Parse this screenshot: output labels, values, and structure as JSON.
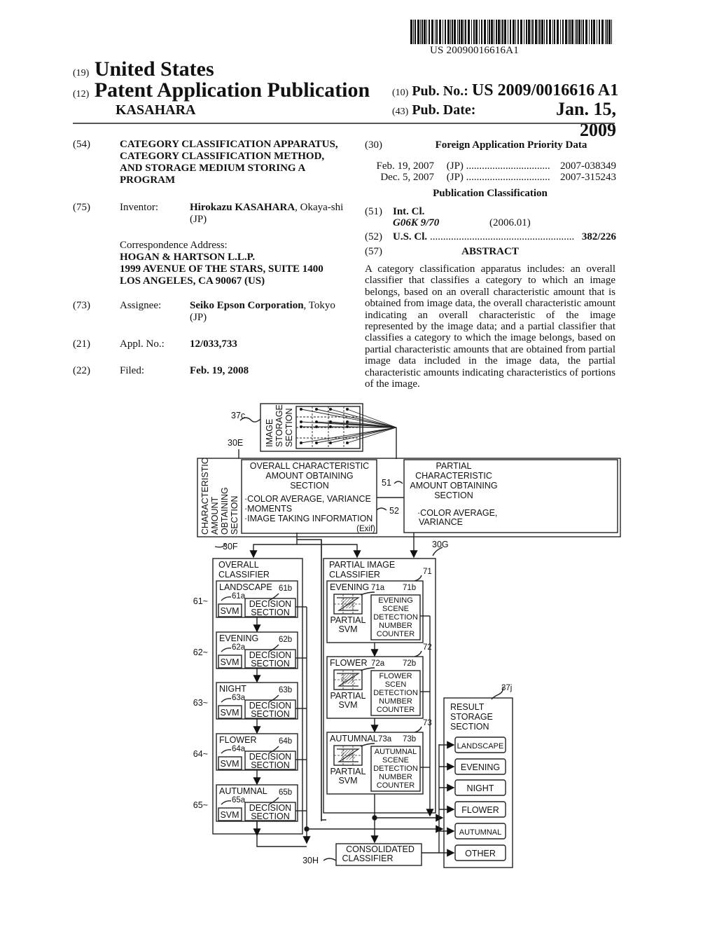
{
  "barcode": {
    "number": "US 20090016616A1"
  },
  "header": {
    "country_code": "(19)",
    "country": "United States",
    "type_code": "(12)",
    "type": "Patent Application Publication",
    "applicant": "KASAHARA",
    "pub_no_code": "(10)",
    "pub_no_label": "Pub. No.:",
    "pub_no": "US 2009/0016616 A1",
    "pub_date_code": "(43)",
    "pub_date_label": "Pub. Date:",
    "pub_date": "Jan. 15, 2009"
  },
  "left": {
    "title_code": "(54)",
    "title_lines": [
      "CATEGORY CLASSIFICATION APPARATUS,",
      "CATEGORY CLASSIFICATION METHOD,",
      "AND STORAGE MEDIUM STORING A",
      "PROGRAM"
    ],
    "inventor_code": "(75)",
    "inventor_label": "Inventor:",
    "inventor_name": "Hirokazu KASAHARA",
    "inventor_loc": ", Okaya-shi",
    "inventor_country": "(JP)",
    "corr_label": "Correspondence Address:",
    "corr_lines": [
      "HOGAN & HARTSON L.L.P.",
      "1999 AVENUE OF THE STARS, SUITE 1400",
      "LOS ANGELES, CA 90067 (US)"
    ],
    "assignee_code": "(73)",
    "assignee_label": "Assignee:",
    "assignee_name": "Seiko Epson Corporation",
    "assignee_loc": ", Tokyo",
    "assignee_country": "(JP)",
    "appl_code": "(21)",
    "appl_label": "Appl. No.:",
    "appl_no": "12/033,733",
    "filed_code": "(22)",
    "filed_label": "Filed:",
    "filed_date": "Feb. 19, 2008"
  },
  "right": {
    "foreign_code": "(30)",
    "foreign_title": "Foreign Application Priority Data",
    "priorities": [
      {
        "date": "Feb. 19, 2007",
        "country": "(JP)",
        "dots": "................................",
        "number": "2007-038349"
      },
      {
        "date": "Dec. 5, 2007",
        "country": "(JP)",
        "dots": "................................",
        "number": "2007-315243"
      }
    ],
    "pub_class_title": "Publication Classification",
    "intcl_code": "(51)",
    "intcl_label": "Int. Cl.",
    "intcl_class": "G06K 9/70",
    "intcl_version": "(2006.01)",
    "uscl_code": "(52)",
    "uscl_label": "U.S. Cl.",
    "uscl_dots": ".......................................................",
    "uscl_value": "382/226",
    "abstract_code": "(57)",
    "abstract_title": "ABSTRACT",
    "abstract_text": "A category classification apparatus includes: an overall classifier that classifies a category to which an image belongs, based on an overall characteristic amount that is obtained from image data, the overall characteristic amount indicating an overall characteristic of the image represented by the image data; and a partial classifier that classifies a category to which the image belongs, based on partial characteristic amounts that are obtained from partial image data included in the image data, the partial characteristic amounts indicating characteristics of portions of the image."
  },
  "figure": {
    "ref_37c": "37c",
    "ref_30e": "30E",
    "image_storage": [
      "IMAGE",
      "STORAGE",
      "SECTION"
    ],
    "char_section": [
      "CHARACTERISTIC",
      "AMOUNT",
      "OBTAINING",
      "SECTION"
    ],
    "overall_char": {
      "title": [
        "OVERALL CHARACTERISTIC",
        "AMOUNT OBTAINING",
        "SECTION"
      ],
      "items": [
        "·COLOR AVERAGE, VARIANCE",
        "·MOMENTS",
        "·IMAGE TAKING INFORMATION"
      ],
      "exif": "(Exif)"
    },
    "ref_51": "51",
    "ref_52": "52",
    "partial_char": {
      "title": [
        "PARTIAL",
        "CHARACTERISTIC",
        "AMOUNT OBTAINING",
        "SECTION"
      ],
      "items": [
        "·COLOR AVERAGE,",
        "VARIANCE"
      ]
    },
    "ref_30f": "30F",
    "ref_30g": "30G",
    "overall_classifier": {
      "title": [
        "OVERALL",
        "CLASSIFIER"
      ],
      "svm": "SVM",
      "decision": [
        "DECISION",
        "SECTION"
      ],
      "subs": [
        {
          "ref": "61",
          "name": "LANDSCAPE",
          "a": "61a",
          "b": "61b"
        },
        {
          "ref": "62",
          "name": "EVENING",
          "a": "62a",
          "b": "62b"
        },
        {
          "ref": "63",
          "name": "NIGHT",
          "a": "63a",
          "b": "63b"
        },
        {
          "ref": "64",
          "name": "FLOWER",
          "a": "64a",
          "b": "64b"
        },
        {
          "ref": "65",
          "name": "AUTUMNAL",
          "a": "65a",
          "b": "65b"
        }
      ]
    },
    "partial_classifier": {
      "title": [
        "PARTIAL IMAGE",
        "CLASSIFIER"
      ],
      "partial_svm": [
        "PARTIAL",
        "SVM"
      ],
      "subs": [
        {
          "ref": "71",
          "name": "EVENING",
          "a": "71a",
          "b": "71b",
          "counter": [
            "EVENING",
            "SCENE",
            "DETECTION",
            "NUMBER",
            "COUNTER"
          ]
        },
        {
          "ref": "72",
          "name": "FLOWER",
          "a": "72a",
          "b": "72b",
          "counter": [
            "FLOWER",
            "SCEN",
            "DETECTION",
            "NUMBER",
            "COUNTER"
          ]
        },
        {
          "ref": "73",
          "name": "AUTUMNAL",
          "a": "73a",
          "b": "73b",
          "counter": [
            "AUTUMNAL",
            "SCENE",
            "DETECTION",
            "NUMBER",
            "COUNTER"
          ]
        }
      ]
    },
    "ref_37j": "37j",
    "result_storage": {
      "title": [
        "RESULT",
        "STORAGE",
        "SECTION"
      ],
      "items": [
        "LANDSCAPE",
        "EVENING",
        "NIGHT",
        "FLOWER",
        "AUTUMNAL",
        "OTHER"
      ]
    },
    "ref_30h": "30H",
    "consolidated": [
      "CONSOLIDATED",
      "CLASSIFIER"
    ]
  }
}
